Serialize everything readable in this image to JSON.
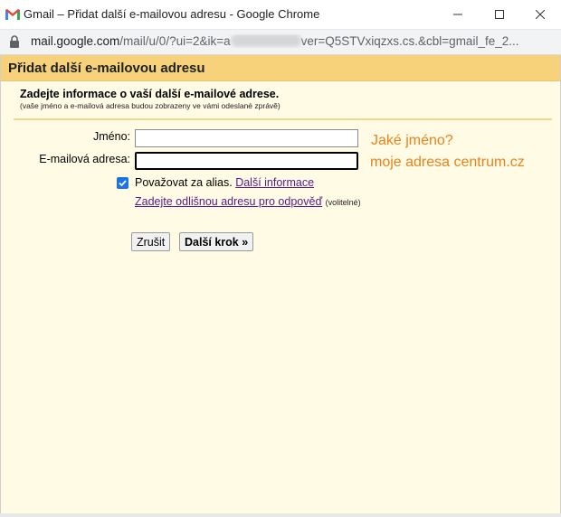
{
  "window": {
    "title": "Gmail – Přidat další e-mailovou adresu - Google Chrome",
    "icons": [
      "gmail-logo",
      "minimize-icon",
      "maximize-icon",
      "close-icon"
    ]
  },
  "addressbar": {
    "host": "mail.google.com",
    "path_before": "/mail/u/0/?ui=2&ik=a",
    "path_after": "ver=Q5STVxiqzxs.cs.&cbl=gmail_fe_2..."
  },
  "dialog": {
    "title": "Přidat další e-mailovou adresu",
    "intro_title": "Zadejte informace o vaší další e-mailové adrese.",
    "intro_note": "(vaše jméno a e-mailová adresa budou zobrazeny ve vámi odeslané zprávě)",
    "name_label": "Jméno:",
    "name_value": "",
    "email_label": "E-mailová adresa:",
    "email_value": "",
    "annotation_name": "Jaké jméno?",
    "annotation_email": "moje adresa centrum.cz",
    "alias_label": "Považovat za alias.",
    "alias_checked": true,
    "more_info_link": "Další informace",
    "reply_to_link": "Zadejte odlišnou adresu pro odpověď",
    "optional_note": "(volitelné)",
    "cancel_button": "Zrušit",
    "next_button": "Další krok »"
  },
  "colors": {
    "header_bg": "#f8d27a",
    "dialog_bg": "#fffbe5",
    "annotation": "#e8821e",
    "checkbox": "#1a73e8",
    "link": "#551a8b"
  }
}
